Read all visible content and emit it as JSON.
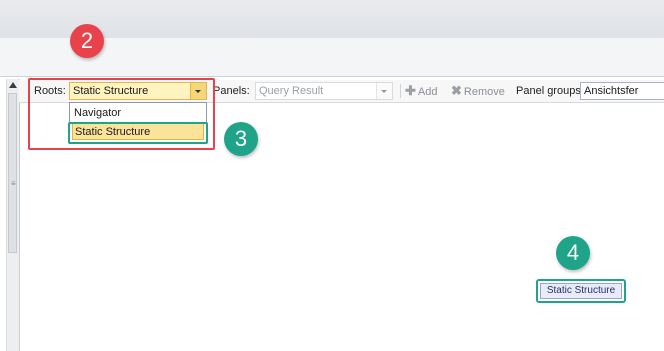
{
  "annotations": {
    "badge2": "2",
    "badge3": "3",
    "badge4": "4"
  },
  "toolbar": {
    "roots_label": "Roots:",
    "roots_value": "Static Structure",
    "panels_label": "Panels:",
    "panels_value": "Query Result",
    "add_label": "Add",
    "remove_label": "Remove",
    "panel_groups_label": "Panel groups:",
    "panel_groups_value": "Ansichtsfer"
  },
  "roots_dropdown": {
    "options": [
      "Navigator",
      "Static Structure"
    ],
    "selected": "Static Structure"
  },
  "node": {
    "label": "Static Structure"
  },
  "icons": {
    "scroll_up": "triangle-up-icon",
    "combo_arrow": "chevron-down-icon",
    "add": "plus-icon",
    "remove": "x-icon"
  },
  "colors": {
    "annotation_red": "#e8424b",
    "annotation_green": "#1fa489",
    "highlight": "#fbe39a"
  }
}
